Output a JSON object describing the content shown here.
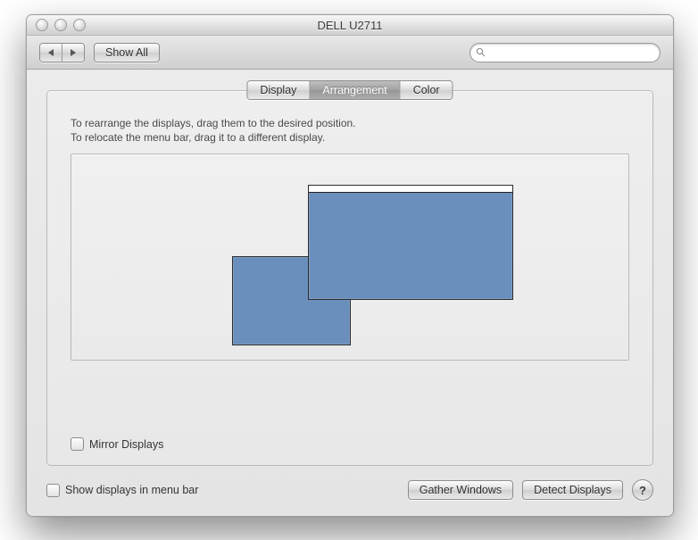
{
  "window": {
    "title": "DELL U2711"
  },
  "toolbar": {
    "show_all_label": "Show All",
    "search_placeholder": ""
  },
  "tabs": {
    "display": "Display",
    "arrangement": "Arrangement",
    "color": "Color",
    "active": "arrangement"
  },
  "arrangement": {
    "instructions_line1": "To rearrange the displays, drag them to the desired position.",
    "instructions_line2": "To relocate the menu bar, drag it to a different display.",
    "mirror_label": "Mirror Displays",
    "mirror_checked": false,
    "displays": [
      {
        "role": "primary",
        "has_menubar": true
      },
      {
        "role": "secondary",
        "has_menubar": false
      }
    ]
  },
  "footer": {
    "show_in_menubar_label": "Show displays in menu bar",
    "show_in_menubar_checked": false,
    "gather_windows_label": "Gather Windows",
    "detect_displays_label": "Detect Displays",
    "help_label": "?"
  },
  "colors": {
    "display_fill": "#6b8fbc",
    "window_bg": "#e7e7e7"
  }
}
